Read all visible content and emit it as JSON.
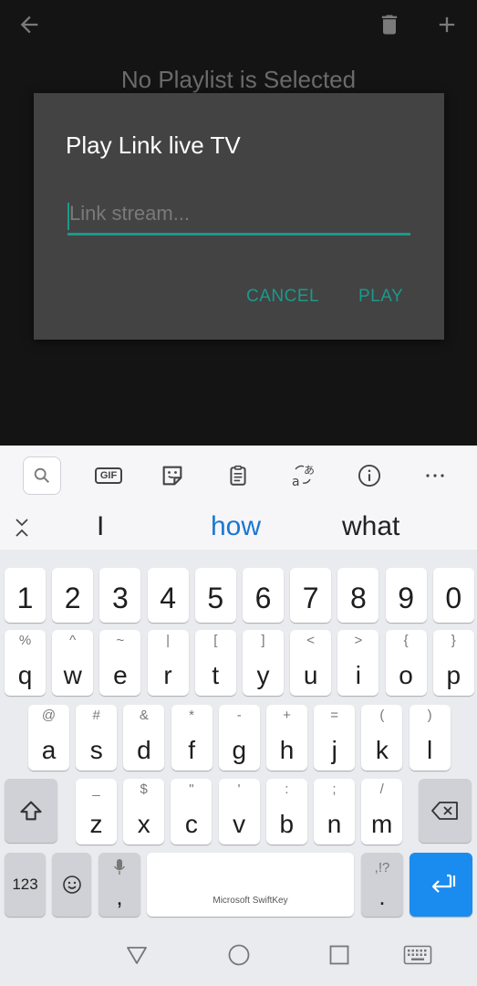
{
  "app": {
    "empty_message": "No Playlist is Selected",
    "icons": {
      "back": "arrow-left-icon",
      "trash": "trash-icon",
      "add": "plus-icon"
    }
  },
  "dialog": {
    "title": "Play Link live TV",
    "input_placeholder": "Link stream...",
    "input_value": "",
    "cancel_label": "CANCEL",
    "play_label": "PLAY",
    "accent_color": "#1a9a8c"
  },
  "keyboard": {
    "toolbar": {
      "gif_label": "GIF",
      "icons": [
        "search-icon",
        "gif-icon",
        "sticker-icon",
        "clipboard-icon",
        "translate-icon",
        "info-icon",
        "more-icon"
      ]
    },
    "suggestions": [
      "I",
      "how",
      "what"
    ],
    "row_numbers": [
      "1",
      "2",
      "3",
      "4",
      "5",
      "6",
      "7",
      "8",
      "9",
      "0"
    ],
    "row1": [
      {
        "k": "q",
        "s": "%"
      },
      {
        "k": "w",
        "s": "^"
      },
      {
        "k": "e",
        "s": "~"
      },
      {
        "k": "r",
        "s": "|"
      },
      {
        "k": "t",
        "s": "["
      },
      {
        "k": "y",
        "s": "]"
      },
      {
        "k": "u",
        "s": "<"
      },
      {
        "k": "i",
        "s": ">"
      },
      {
        "k": "o",
        "s": "{"
      },
      {
        "k": "p",
        "s": "}"
      }
    ],
    "row2": [
      {
        "k": "a",
        "s": "@"
      },
      {
        "k": "s",
        "s": "#"
      },
      {
        "k": "d",
        "s": "&"
      },
      {
        "k": "f",
        "s": "*"
      },
      {
        "k": "g",
        "s": "-"
      },
      {
        "k": "h",
        "s": "+"
      },
      {
        "k": "j",
        "s": "="
      },
      {
        "k": "k",
        "s": "("
      },
      {
        "k": "l",
        "s": ")"
      }
    ],
    "row3": [
      {
        "k": "z",
        "s": "_"
      },
      {
        "k": "x",
        "s": "$"
      },
      {
        "k": "c",
        "s": "\""
      },
      {
        "k": "v",
        "s": "'"
      },
      {
        "k": "b",
        "s": ":"
      },
      {
        "k": "n",
        "s": ";"
      },
      {
        "k": "m",
        "s": "/"
      }
    ],
    "bottom": {
      "numbers_label": "123",
      "comma_label": ",",
      "space_label": "Microsoft SwiftKey",
      "period_label": ".",
      "period_sub": ",!?"
    },
    "enter_color": "#1a8cf0"
  },
  "navbar": {
    "icons": [
      "back-triangle-icon",
      "home-circle-icon",
      "recents-square-icon",
      "keyboard-switch-icon"
    ]
  }
}
